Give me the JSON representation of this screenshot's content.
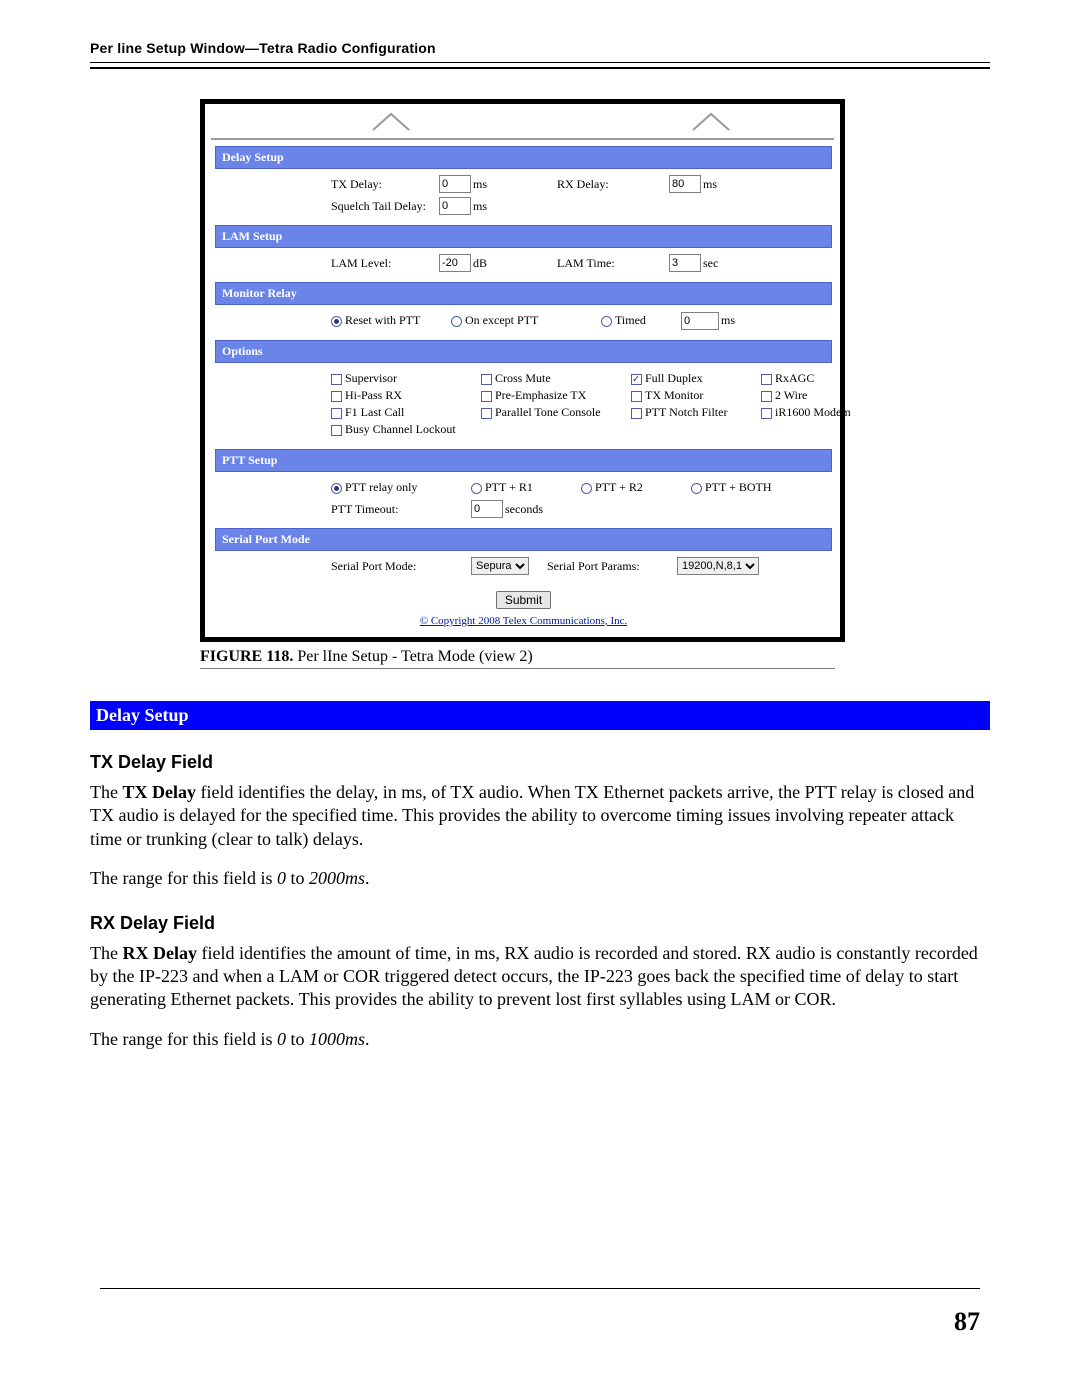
{
  "header": {
    "title": "Per line Setup Window—Tetra Radio Configuration"
  },
  "figure": {
    "caption_prefix": "FIGURE 118.",
    "caption_text": "Per lIne Setup - Tetra Mode (view 2)",
    "copyright": "© Copyright 2008 Telex Communications, Inc."
  },
  "delay_setup": {
    "title": "Delay Setup",
    "tx_label": "TX Delay:",
    "tx_value": "0",
    "tx_unit": "ms",
    "rx_label": "RX Delay:",
    "rx_value": "80",
    "rx_unit": "ms",
    "sq_label": "Squelch Tail Delay:",
    "sq_value": "0",
    "sq_unit": "ms"
  },
  "lam_setup": {
    "title": "LAM Setup",
    "lvl_label": "LAM Level:",
    "lvl_value": "-20",
    "lvl_unit": "dB",
    "time_label": "LAM Time:",
    "time_value": "3",
    "time_unit": "sec"
  },
  "monitor_relay": {
    "title": "Monitor Relay",
    "r1": "Reset with PTT",
    "r2": "On except PTT",
    "r3": "Timed",
    "timed_value": "0",
    "timed_unit": "ms"
  },
  "options": {
    "title": "Options",
    "col1": [
      "Supervisor",
      "Hi-Pass RX",
      "F1 Last Call",
      "Busy Channel Lockout"
    ],
    "col2": [
      "Cross Mute",
      "Pre-Emphasize TX",
      "Parallel Tone Console"
    ],
    "col3": [
      "Full Duplex",
      "TX Monitor",
      "PTT Notch Filter"
    ],
    "col4": [
      "RxAGC",
      "2 Wire",
      "iR1600 Modem"
    ],
    "checked": "Full Duplex"
  },
  "ptt_setup": {
    "title": "PTT Setup",
    "r1": "PTT relay only",
    "r2": "PTT + R1",
    "r3": "PTT + R2",
    "r4": "PTT + BOTH",
    "timeout_label": "PTT Timeout:",
    "timeout_value": "0",
    "timeout_unit": "seconds"
  },
  "serial": {
    "title": "Serial Port Mode",
    "mode_label": "Serial Port Mode:",
    "mode_value": "Sepura",
    "params_label": "Serial Port Params:",
    "params_value": "19200,N,8,1"
  },
  "submit": {
    "label": "Submit"
  },
  "doc": {
    "blue_bar": "Delay Setup",
    "h_tx": "TX Delay Field",
    "p_tx_1a": "The ",
    "p_tx_1b": "TX Delay",
    "p_tx_1c": " field identifies the delay, in ms, of TX audio. When TX Ethernet packets arrive, the PTT relay is closed and TX audio is delayed for the specified time. This provides the ability to overcome timing issues involving repeater attack time or trunking (clear to talk) delays.",
    "p_tx_2a": "The range for this field is ",
    "p_tx_2b": "0",
    "p_tx_2c": " to ",
    "p_tx_2d": "2000ms",
    "p_tx_2e": ".",
    "h_rx": "RX Delay Field",
    "p_rx_1a": "The ",
    "p_rx_1b": "RX Delay",
    "p_rx_1c": " field identifies the amount of time, in ms, RX audio is recorded and stored. RX audio is constantly recorded by the IP-223 and when a LAM or COR triggered detect occurs, the IP-223 goes back the specified time of delay to start generating Ethernet packets. This provides the ability to prevent lost first syllables using LAM or COR.",
    "p_rx_2a": "The range for this field is ",
    "p_rx_2b": "0",
    "p_rx_2c": " to ",
    "p_rx_2d": "1000ms",
    "p_rx_2e": "."
  },
  "page_number": "87"
}
